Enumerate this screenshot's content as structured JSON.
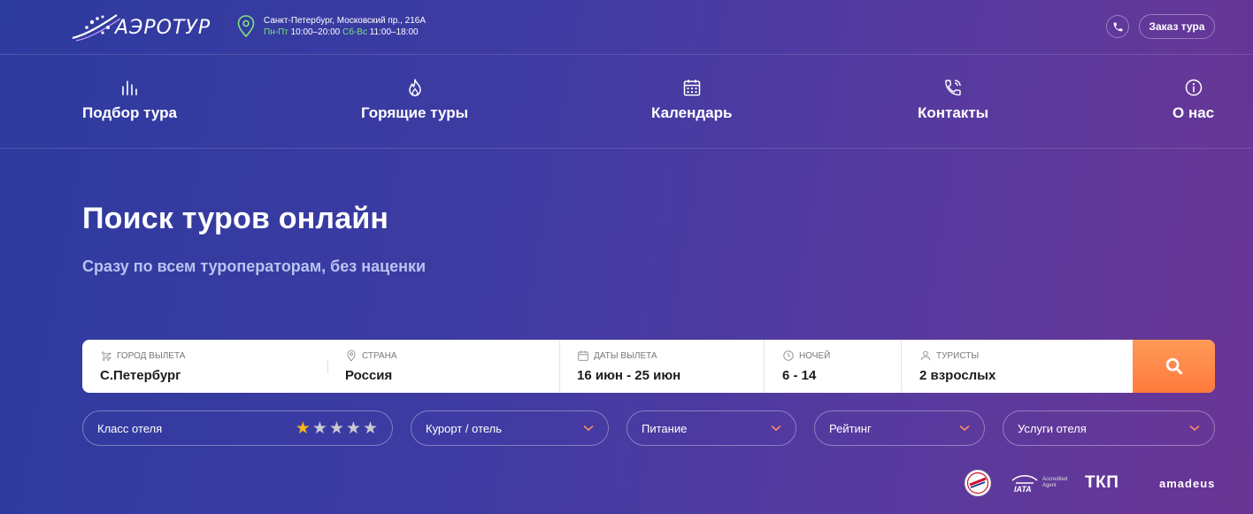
{
  "header": {
    "logo_text": "АЭРОТУР",
    "address": "Санкт-Петербург, Московский пр., 216А",
    "hours_weekdays_label": "Пн-Пт",
    "hours_weekdays": "10:00–20:00",
    "hours_weekend_label": "Сб-Вс",
    "hours_weekend": "11:00–18:00",
    "order_button": "Заказ тура"
  },
  "nav": {
    "items": [
      {
        "label": "Подбор тура",
        "icon": "chart-bars-icon"
      },
      {
        "label": "Горящие туры",
        "icon": "fire-icon"
      },
      {
        "label": "Календарь",
        "icon": "calendar-icon"
      },
      {
        "label": "Контакты",
        "icon": "phone-call-icon"
      },
      {
        "label": "О нас",
        "icon": "info-icon"
      }
    ]
  },
  "hero": {
    "title": "Поиск туров онлайн",
    "subtitle": "Сразу по всем туроператорам, без наценки"
  },
  "search": {
    "departure_label": "Город вылета",
    "departure_value": "С.Петербург",
    "country_label": "Страна",
    "country_value": "Россия",
    "dates_label": "Даты вылета",
    "dates_value": "16 июн - 25 июн",
    "nights_label": "Ночей",
    "nights_value": "6 - 14",
    "tourists_label": "Туристы",
    "tourists_value": "2 взрослых"
  },
  "filters": {
    "hotel_class": "Класс отеля",
    "hotel_class_rating": 1,
    "hotel_class_max": 5,
    "resort": "Курорт / отель",
    "meals": "Питание",
    "rating": "Рейтинг",
    "services": "Услуги отеля"
  },
  "badges": {
    "iata": "IATA",
    "iata_note": "Accredited Agent",
    "tkp": "ТКП",
    "amadeus": "amadeus"
  },
  "colors": {
    "accent_orange": "#ff8a45",
    "star_on": "#f5b31c",
    "hours_green": "#7ee27e"
  }
}
